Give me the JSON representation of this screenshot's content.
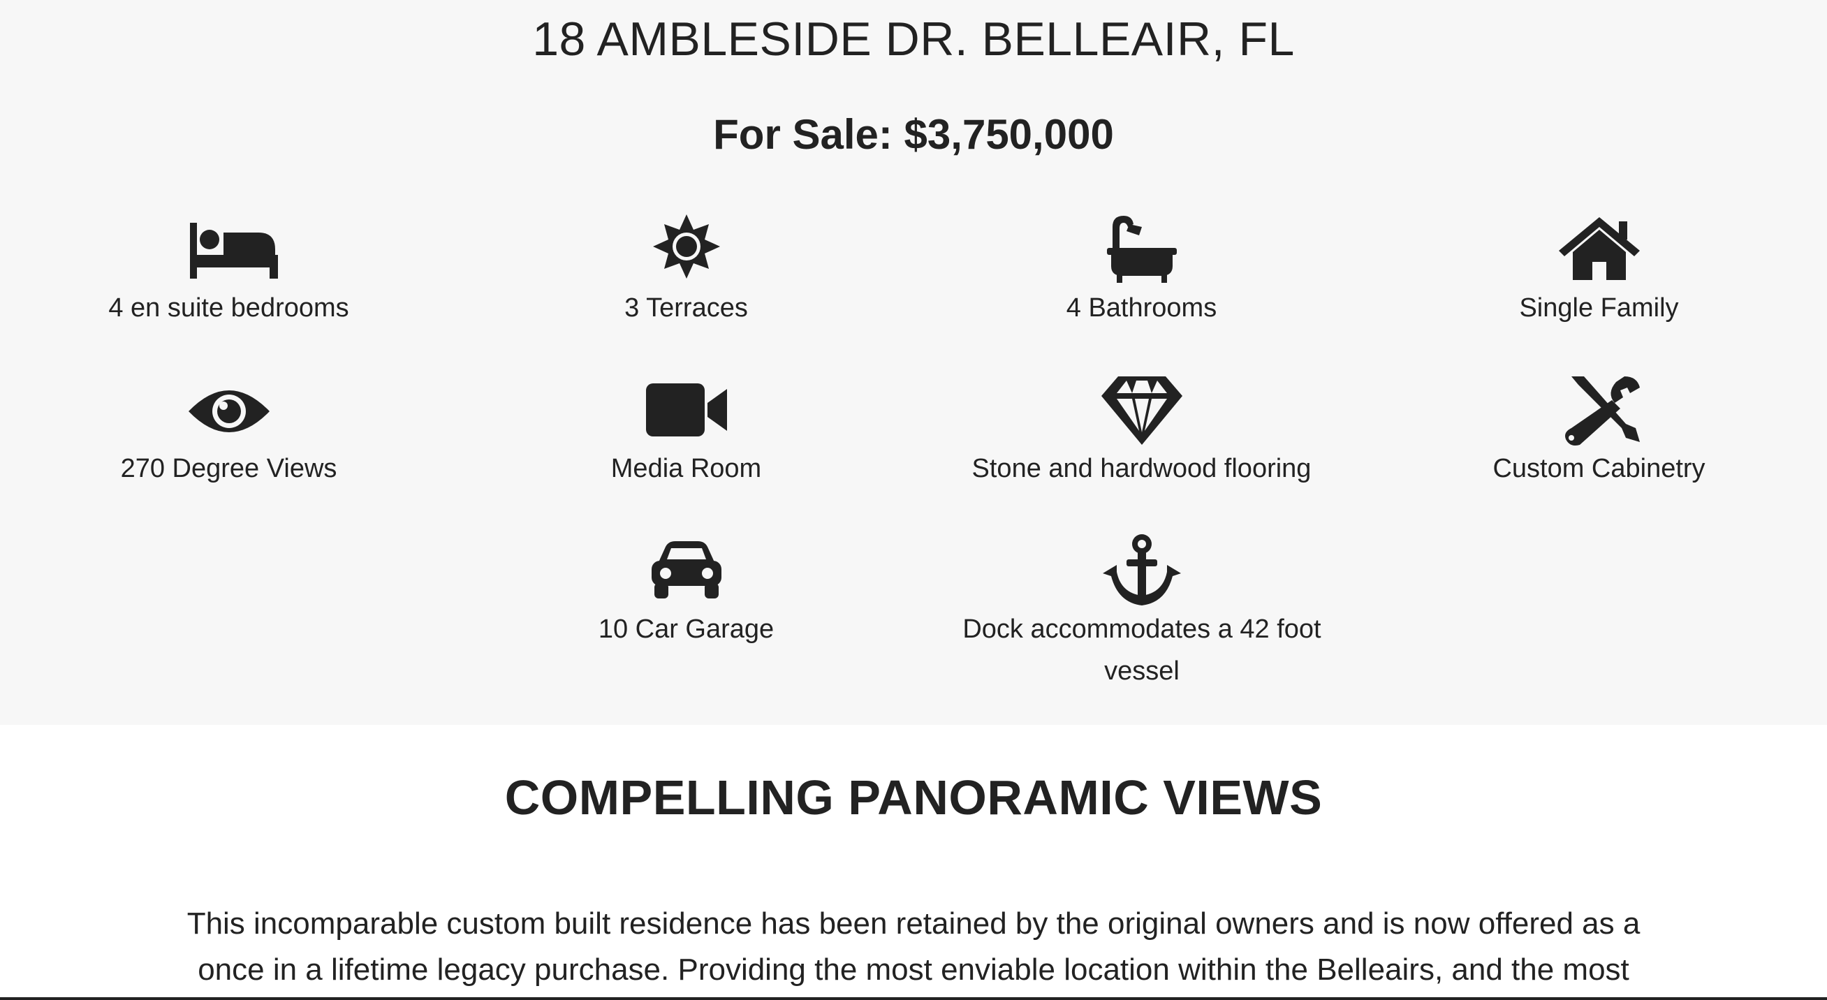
{
  "header": {
    "address": "18 AMBLESIDE DR. BELLEAIR, FL",
    "price": "For Sale: $3,750,000"
  },
  "features": [
    {
      "icon": "bed-icon",
      "label": "4 en suite bedrooms"
    },
    {
      "icon": "sun-icon",
      "label": "3 Terraces"
    },
    {
      "icon": "bathtub-icon",
      "label": "4 Bathrooms"
    },
    {
      "icon": "house-icon",
      "label": "Single Family"
    },
    {
      "icon": "eye-icon",
      "label": "270 Degree Views"
    },
    {
      "icon": "video-camera-icon",
      "label": "Media Room"
    },
    {
      "icon": "diamond-icon",
      "label": "Stone and hardwood flooring"
    },
    {
      "icon": "tools-icon",
      "label": "Custom Cabinetry"
    },
    {
      "icon": "car-icon",
      "label": "10 Car Garage"
    },
    {
      "icon": "anchor-icon",
      "label": "Dock accommodates a 42 foot vessel"
    }
  ],
  "section": {
    "title": "COMPELLING PANORAMIC VIEWS",
    "paragraph": "This incomparable custom built residence has been retained by the original owners and is now offered as a once in a lifetime legacy purchase. Providing the most enviable location within the Belleairs, and the most"
  },
  "colors": {
    "text": "#222222",
    "band_background": "#f7f7f7",
    "page_background": "#ffffff"
  }
}
